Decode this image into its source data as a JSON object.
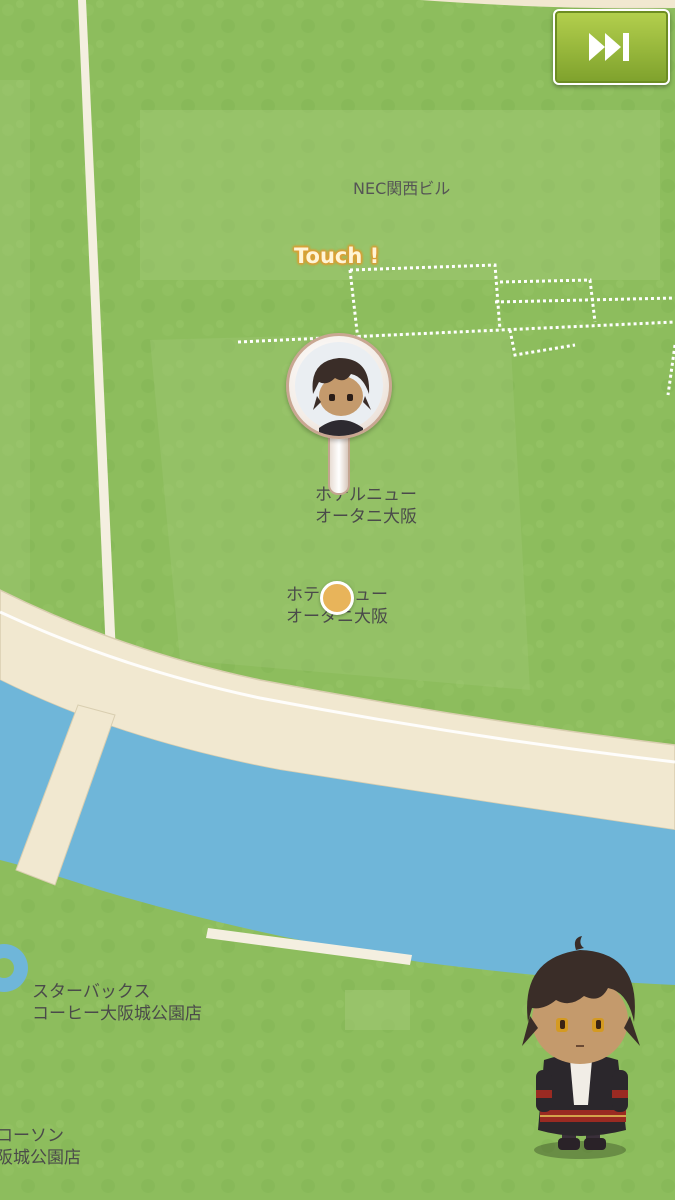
{
  "controls": {
    "skip_button": {
      "icon": "fast-forward-icon"
    },
    "touch_hint": "Touch !"
  },
  "map": {
    "labels": {
      "nec_building": "NEC関西ビル",
      "hotel_new_otani_a": "ホテルニュー\nオータニ大阪",
      "hotel_new_otani_b": "ホテルニュー\nオータニ大阪",
      "starbucks": "スターバックス\nコーヒー大阪城公園店",
      "lawson": "ローソン\n阪城公園店"
    },
    "colors": {
      "grass": "#8cbc5c",
      "road": "#f1e8d0",
      "water": "#6fb6d9",
      "accent_orange": "#e8b45a",
      "skip_green": "#94b83a"
    }
  },
  "pins": {
    "character_pin": {
      "icon": "character-portrait-icon"
    },
    "location_marker": {
      "icon": "location-dot-icon"
    }
  },
  "player": {
    "icon": "chibi-character-icon"
  }
}
